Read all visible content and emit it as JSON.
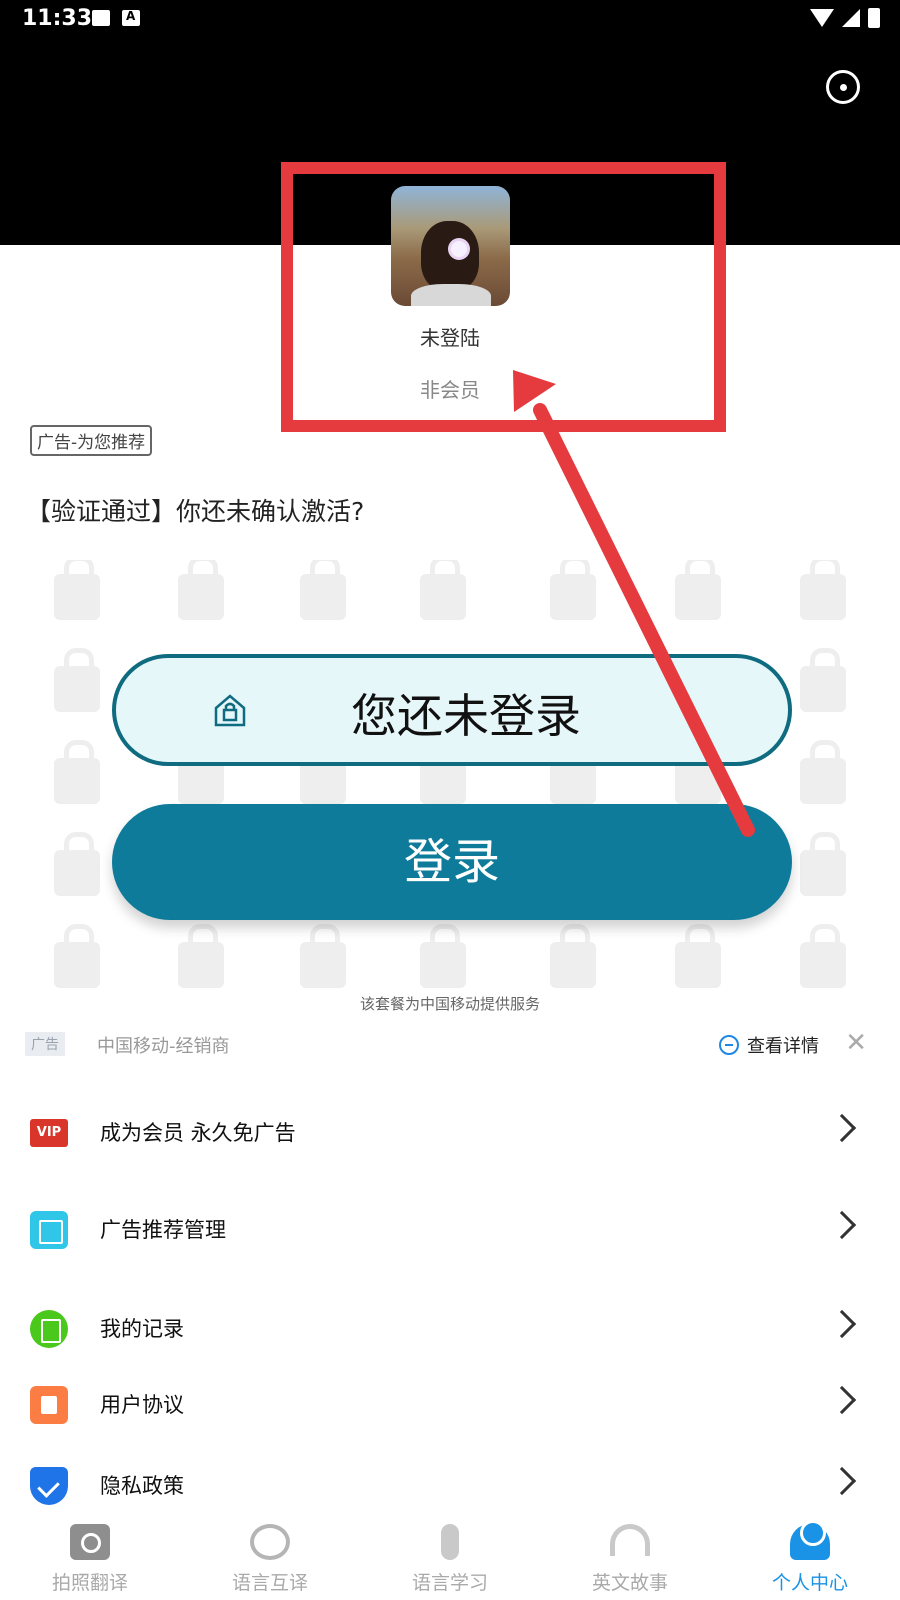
{
  "status_bar": {
    "time": "11:33"
  },
  "profile": {
    "username": "未登陆",
    "membership": "非会员"
  },
  "ad": {
    "tag": "广告-为您推荐",
    "title": "【验证通过】你还未确认激活?",
    "not_logged_in_text": "您还未登录",
    "login_button": "登录",
    "service_note": "该套餐为中国移动提供服务",
    "badge": "广告",
    "source": "中国移动-经销商",
    "detail_link": "查看详情"
  },
  "menu": {
    "items": [
      {
        "label": "成为会员 永久免广告",
        "icon": "vip-icon",
        "icon_text": "VIP"
      },
      {
        "label": "广告推荐管理",
        "icon": "ad-manage-icon"
      },
      {
        "label": "我的记录",
        "icon": "record-icon"
      },
      {
        "label": "用户协议",
        "icon": "agreement-icon"
      },
      {
        "label": "隐私政策",
        "icon": "privacy-shield-icon"
      }
    ]
  },
  "bottom_nav": {
    "items": [
      {
        "label": "拍照翻译",
        "icon": "camera-icon"
      },
      {
        "label": "语言互译",
        "icon": "translate-chat-icon"
      },
      {
        "label": "语言学习",
        "icon": "microphone-icon"
      },
      {
        "label": "英文故事",
        "icon": "headphones-icon"
      },
      {
        "label": "个人中心",
        "icon": "person-icon"
      }
    ],
    "active_index": 4
  },
  "colors": {
    "header_bg": "#000000",
    "annotation_red": "#e53a3e",
    "login_teal": "#0e7b9a",
    "active_blue": "#1a92e6"
  }
}
